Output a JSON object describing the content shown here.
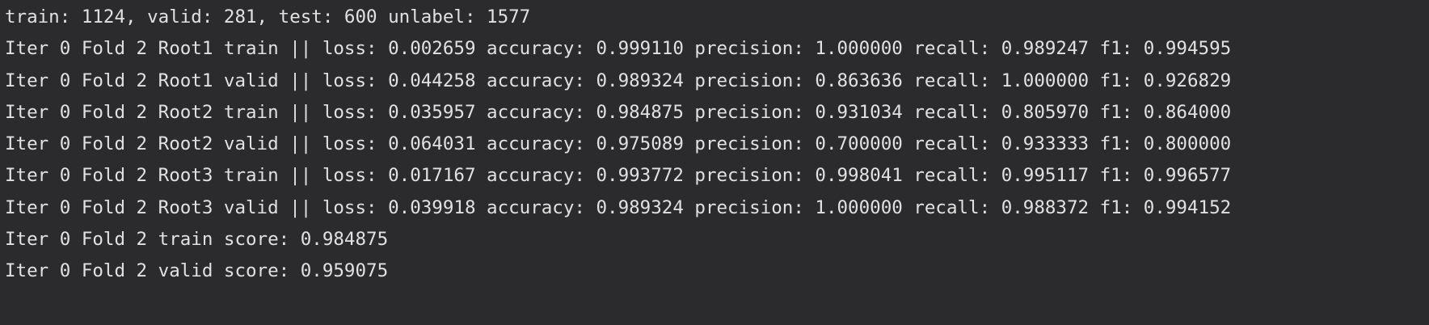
{
  "console": {
    "lines": [
      "train: 1124, valid: 281, test: 600 unlabel: 1577",
      "Iter 0 Fold 2 Root1 train || loss: 0.002659 accuracy: 0.999110 precision: 1.000000 recall: 0.989247 f1: 0.994595",
      "Iter 0 Fold 2 Root1 valid || loss: 0.044258 accuracy: 0.989324 precision: 0.863636 recall: 1.000000 f1: 0.926829",
      "Iter 0 Fold 2 Root2 train || loss: 0.035957 accuracy: 0.984875 precision: 0.931034 recall: 0.805970 f1: 0.864000",
      "Iter 0 Fold 2 Root2 valid || loss: 0.064031 accuracy: 0.975089 precision: 0.700000 recall: 0.933333 f1: 0.800000",
      "Iter 0 Fold 2 Root3 train || loss: 0.017167 accuracy: 0.993772 precision: 0.998041 recall: 0.995117 f1: 0.996577",
      "Iter 0 Fold 2 Root3 valid || loss: 0.039918 accuracy: 0.989324 precision: 1.000000 recall: 0.988372 f1: 0.994152",
      "Iter 0 Fold 2 train score: 0.984875",
      "Iter 0 Fold 2 valid score: 0.959075"
    ]
  },
  "colors": {
    "background": "#2b2b2d",
    "text": "#e1e1e1"
  }
}
